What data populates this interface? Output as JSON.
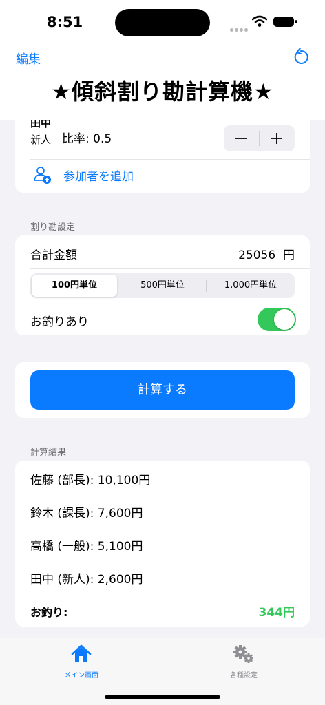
{
  "status": {
    "time": "8:51"
  },
  "nav": {
    "edit_label": "編集",
    "title": "★傾斜割り勘計算機★"
  },
  "participant": {
    "name_top": "田中",
    "role": "新人",
    "ratio": "比率: 0.5",
    "minus": "−",
    "plus": "+"
  },
  "add_participant": "参加者を追加",
  "settings": {
    "section": "割り勘設定",
    "total_label": "合計金額",
    "total_value": "25056",
    "currency": "円",
    "units": [
      "100円単位",
      "500円単位",
      "1,000円単位"
    ],
    "selected_unit": 0,
    "change_label": "お釣りあり",
    "change_on": true
  },
  "calculate_label": "計算する",
  "results": {
    "section": "計算結果",
    "rows": [
      "佐藤 (部長): 10,100円",
      "鈴木 (課長): 7,600円",
      "高橋 (一般): 5,100円",
      "田中 (新人): 2,600円"
    ],
    "change_label": "お釣り:",
    "change_value": "344円"
  },
  "tabs": [
    {
      "label": "メイン画面",
      "icon": "house-icon",
      "active": true
    },
    {
      "label": "各種設定",
      "icon": "gear-icon",
      "active": false
    }
  ],
  "colors": {
    "accent": "#0a7aff",
    "green": "#34c759",
    "background": "#f2f2f7"
  }
}
